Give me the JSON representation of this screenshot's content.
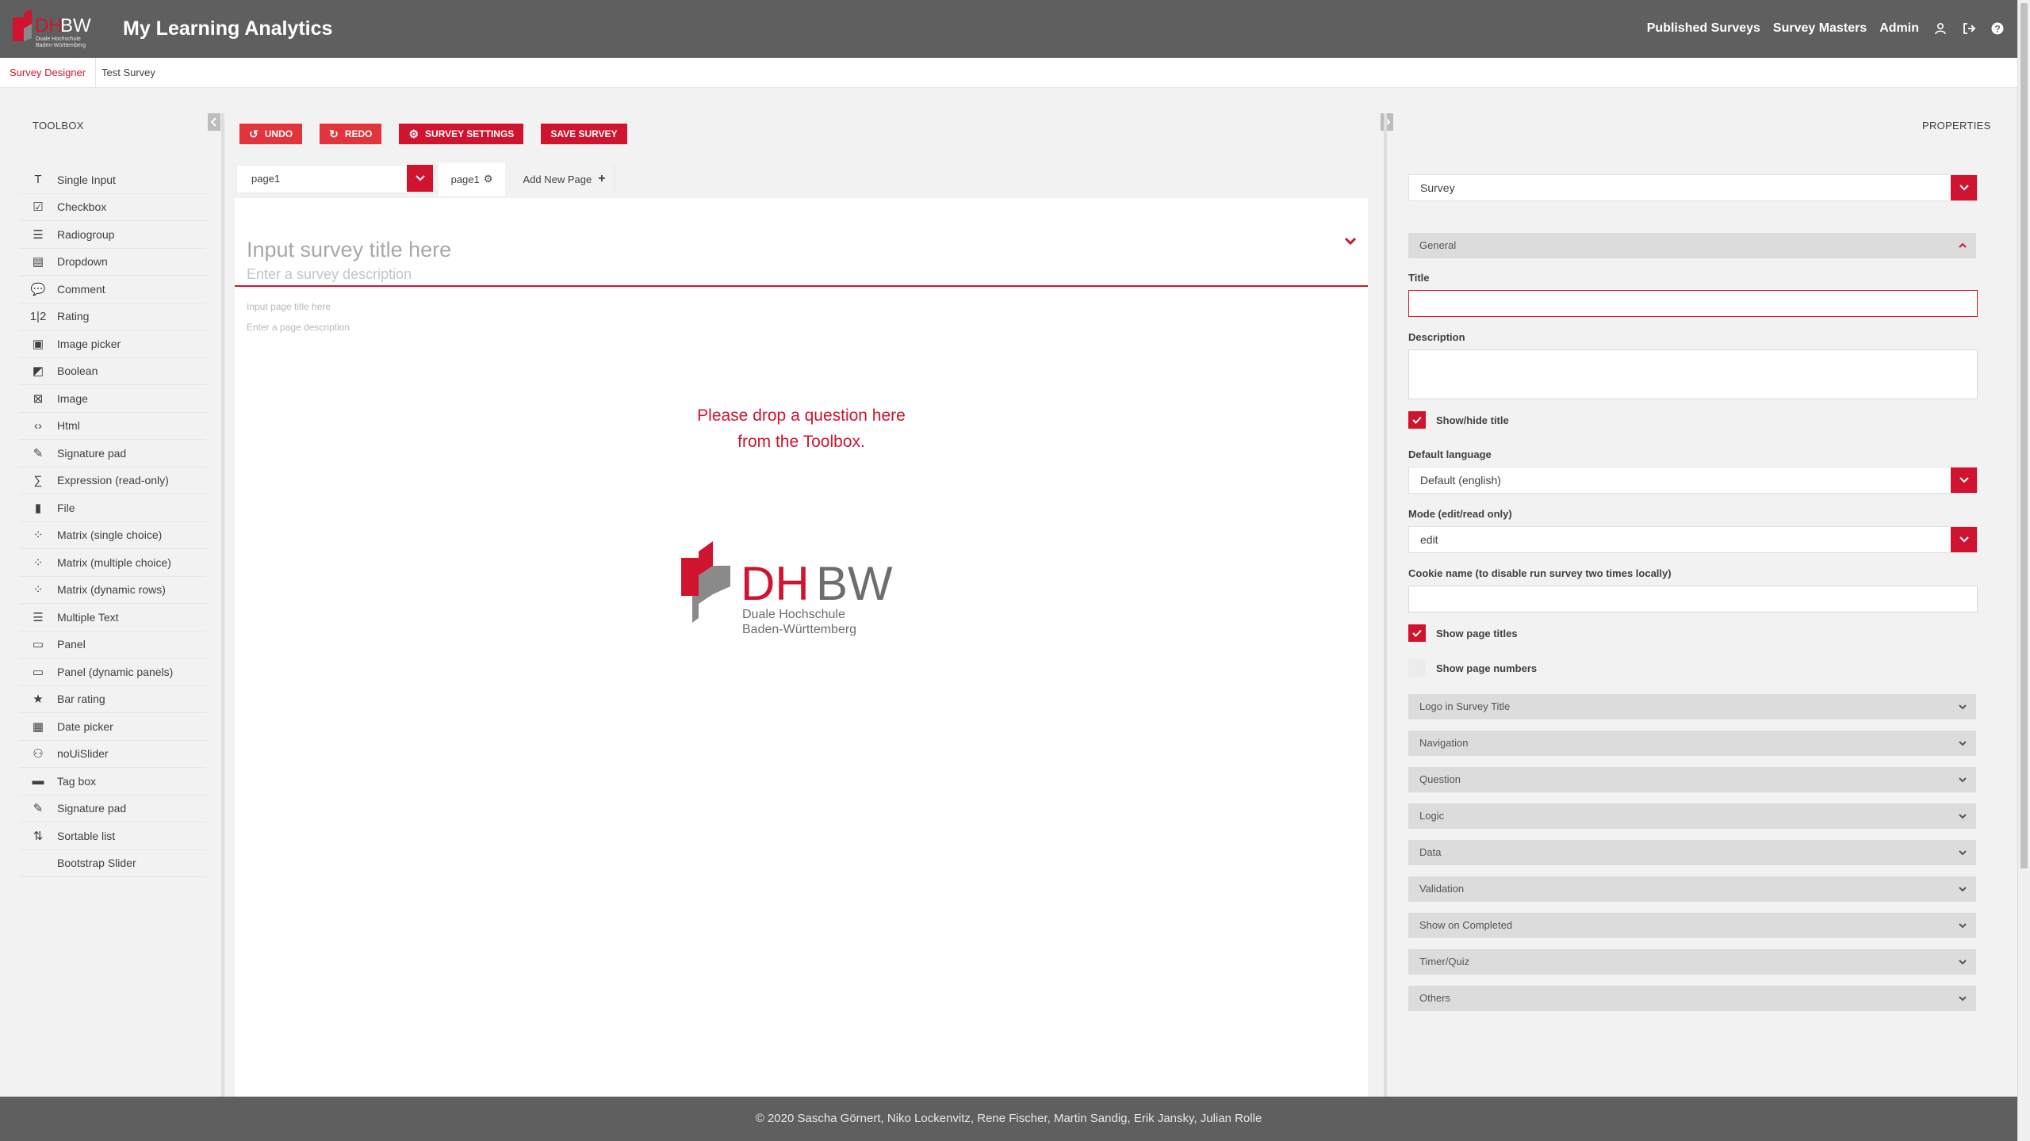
{
  "header": {
    "logo_letters": "DHBW",
    "logo_subtitle_1": "Duale Hochschule",
    "logo_subtitle_2": "Baden-Württemberg",
    "app_title": "My Learning Analytics",
    "nav": [
      "Published Surveys",
      "Survey Masters",
      "Admin"
    ],
    "icons": [
      "user-icon",
      "logout-icon",
      "help-icon"
    ]
  },
  "tabs": {
    "designer": "Survey Designer",
    "test": "Test Survey"
  },
  "toolbox": {
    "title": "TOOLBOX",
    "items": [
      {
        "label": "Single Input",
        "icon": "T"
      },
      {
        "label": "Checkbox",
        "icon": "☑"
      },
      {
        "label": "Radiogroup",
        "icon": "☰"
      },
      {
        "label": "Dropdown",
        "icon": "▤"
      },
      {
        "label": "Comment",
        "icon": "💬"
      },
      {
        "label": "Rating",
        "icon": "1|2"
      },
      {
        "label": "Image picker",
        "icon": "▣"
      },
      {
        "label": "Boolean",
        "icon": "◩"
      },
      {
        "label": "Image",
        "icon": "⊠"
      },
      {
        "label": "Html",
        "icon": "‹›"
      },
      {
        "label": "Signature pad",
        "icon": "✎"
      },
      {
        "label": "Expression (read-only)",
        "icon": "∑"
      },
      {
        "label": "File",
        "icon": "▮"
      },
      {
        "label": "Matrix (single choice)",
        "icon": "⁘"
      },
      {
        "label": "Matrix (multiple choice)",
        "icon": "⁘"
      },
      {
        "label": "Matrix (dynamic rows)",
        "icon": "⁘"
      },
      {
        "label": "Multiple Text",
        "icon": "☰"
      },
      {
        "label": "Panel",
        "icon": "▭"
      },
      {
        "label": "Panel (dynamic panels)",
        "icon": "▭"
      },
      {
        "label": "Bar rating",
        "icon": "★"
      },
      {
        "label": "Date picker",
        "icon": "▦"
      },
      {
        "label": "noUiSlider",
        "icon": "⚇"
      },
      {
        "label": "Tag box",
        "icon": "▬"
      },
      {
        "label": "Signature pad",
        "icon": "✎"
      },
      {
        "label": "Sortable list",
        "icon": "⇅"
      },
      {
        "label": "Bootstrap Slider",
        "icon": ""
      }
    ]
  },
  "editor": {
    "undo": "UNDO",
    "redo": "REDO",
    "settings": "SURVEY SETTINGS",
    "save": "SAVE SURVEY",
    "page_select_value": "page1",
    "page_tab": "page1",
    "add_page": "Add New Page",
    "survey_title_placeholder": "Input survey title here",
    "survey_desc_placeholder": "Enter a survey description",
    "page_title_placeholder": "Input page title here",
    "page_desc_placeholder": "Enter a page description",
    "drop_hint_1": "Please drop a question here",
    "drop_hint_2": "from the Toolbox."
  },
  "properties": {
    "title": "PROPERTIES",
    "object_select": "Survey",
    "general": "General",
    "title_label": "Title",
    "title_value": "",
    "description_label": "Description",
    "description_value": "",
    "show_hide_title": "Show/hide title",
    "show_hide_title_checked": true,
    "default_language_label": "Default language",
    "default_language_value": "Default (english)",
    "mode_label": "Mode (edit/read only)",
    "mode_value": "edit",
    "cookie_label": "Cookie name (to disable run survey two times locally)",
    "cookie_value": "",
    "show_page_titles": "Show page titles",
    "show_page_titles_checked": true,
    "show_page_numbers": "Show page numbers",
    "show_page_numbers_checked": false,
    "sections": [
      "Logo in Survey Title",
      "Navigation",
      "Question",
      "Logic",
      "Data",
      "Validation",
      "Show on Completed",
      "Timer/Quiz",
      "Others"
    ]
  },
  "footer": {
    "text": "© 2020 Sascha Görnert, Niko Lockenvitz, Rene Fischer, Martin Sandig, Erik Jansky, Julian Rolle"
  },
  "colors": {
    "accent": "#d0142f",
    "topbar": "#5f5f5f",
    "background": "#f2f2f2"
  }
}
